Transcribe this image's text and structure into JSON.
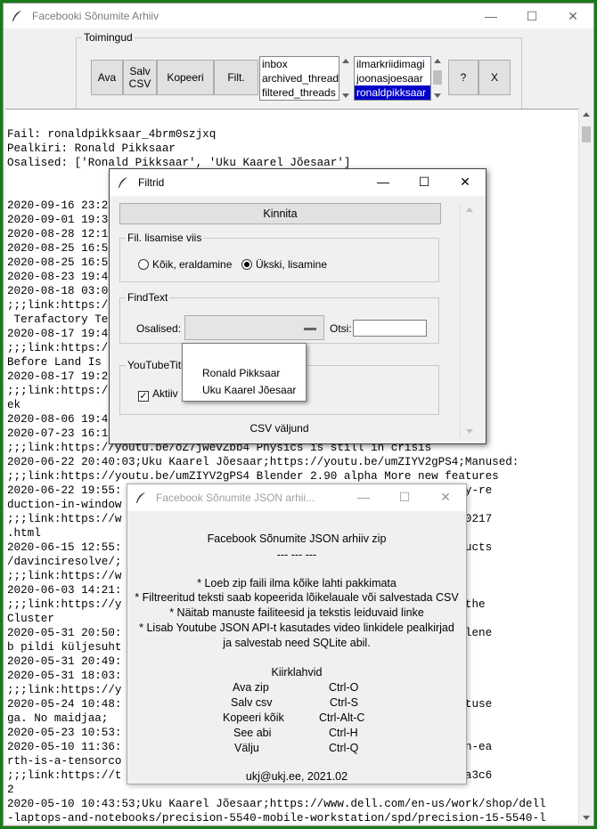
{
  "main_window": {
    "title": "Facebooki Sõnumite Arhiiv",
    "controls": {
      "minimize": "—",
      "maximize": "☐",
      "close": "✕"
    }
  },
  "toolbar": {
    "group_label": "Toimingud",
    "open_label": "Ava",
    "save_csv_label": "Salv\nCSV",
    "copy_label": "Kopeeri",
    "filter_label": "Filt.",
    "help_label": "?",
    "exit_label": "X"
  },
  "folders_list": [
    "inbox",
    "archived_thread",
    "filtered_threads"
  ],
  "threads_list": {
    "items": [
      "ilmarkriidimagi",
      "joonasjoesaar",
      "ronaldpikksaar"
    ],
    "selected_index": 2
  },
  "text_lines": [
    "Fail: ronaldpikksaar_4brm0szjxq",
    "Pealkiri: Ronald Pikksaar",
    "Osalised: ['Ronald Pikksaar', 'Uku Kaarel Jõesaar']",
    "",
    "",
    "2020-09-16 23:2",
    "2020-09-01 19:3",
    "2020-08-28 12:1",
    "2020-08-25 16:5",
    "2020-08-25 16:5",
    "2020-08-23 19:4",
    "2020-08-18 03:0                                         ;Manused:",
    ";;;link:https:/                                          17/20 - Tesla",
    " Terafactory Te",
    "2020-08-17 19:4                                         ;Manused:",
    ";;;link:https:/                                         rk Can Begin",
    "Before Land Is",
    "2020-08-17 19:2                                         ;Manused:",
    ";;;link:https:/                                         plete Next We",
    "ek",
    "2020-08-06 19:4",
    "2020-07-23 16:1                                         ;Manused:",
    ";;;link:https://youtu.be/oZ7jwevZbb4 Physics is still in crisis",
    "2020-06-22 20:40:03;Uku Kaarel Jõesaar;https://youtu.be/umZIYV2gPS4;Manused:",
    ";;;link:https://youtu.be/umZIYV2gPS4 Blender 2.90 alpha More new features",
    "2020-06-22 19:55:                                        hrome-memory-re",
    "duction-in-window",
    ";;;link:https://w                                        ws-10-201440217",
    ".html",
    "2020-06-15 12:55:                                        gn.com/products",
    "/davinciresolve/;",
    ";;;link:https://w",
    "2020-06-03 14:21:                                        Lo;Manused:",
    ";;;link:https://y                                        Setting up the",
    "Cluster",
    "2020-05-31 20:50:                                        halvasti, olene",
    "b pildi küljesuht",
    "2020-05-31 20:49:                                         ekraan.;",
    "2020-05-31 18:03:                                        YQ;Manused:",
    ";;;link:https://y                                        mputer",
    "2020-05-24 10:48:                                        äiksema toetuse",
    "ga. No maidjaa;",
    "2020-05-23 10:53:",
    "2020-05-10 11:36:                                        .com/what-on-ea",
    "rth-is-a-tensorco",
    ";;;link:https://t                                        ore-bad6208a3c6",
    "2",
    "2020-05-10 10:43:53;Uku Kaarel Jõesaar;https://www.dell.com/en-us/work/shop/dell",
    "-laptops-and-notebooks/precision-5540-mobile-workstation/spd/precision-15-5540-l"
  ],
  "filter_dialog": {
    "title": "Filtrid",
    "confirm_label": "Kinnita",
    "add_mode_group": "Fil. lisamise viis",
    "option_all": "Kõik, eraldamine",
    "option_one": "Ükski, lisamine",
    "selected_option": "option_one",
    "findtext_group": "FindText",
    "participants_label": "Osalised:",
    "search_label": "Otsi:",
    "search_value": "",
    "youtube_group": "YouTubeTitl",
    "active_label": "Aktiiv",
    "active_checked": true,
    "csv_export_label": "CSV väljund"
  },
  "participants_dropdown": [
    "Ronald Pikksaar",
    "Uku Kaarel Jõesaar"
  ],
  "about_dialog": {
    "title": "Facebook Sõnumite JSON arhii...",
    "heading": "Facebook Sõnumite JSON arhiiv zip",
    "separator": "--- --- ---",
    "features": [
      "* Loeb zip faili ilma kõike lahti pakkimata",
      "* Filtreeritud teksti saab kopeerida lõikelauale või salvestada CSV",
      "* Näitab manuste failiteesid ja tekstis leiduvaid linke",
      "* Lisab Youtube JSON API-t kasutades video linkidele pealkirjad",
      "ja salvestab need SQLite abil."
    ],
    "shortcuts_title": "Kiirklahvid",
    "shortcuts": [
      {
        "action": "Ava zip",
        "key": "Ctrl-O"
      },
      {
        "action": "Salv csv",
        "key": "Ctrl-S"
      },
      {
        "action": "Kopeeri kõik",
        "key": "Ctrl-Alt-C"
      },
      {
        "action": "See abi",
        "key": "Ctrl-H"
      },
      {
        "action": "Välju",
        "key": "Ctrl-Q"
      }
    ],
    "footer": "ukj@ukj.ee, 2021.02"
  }
}
